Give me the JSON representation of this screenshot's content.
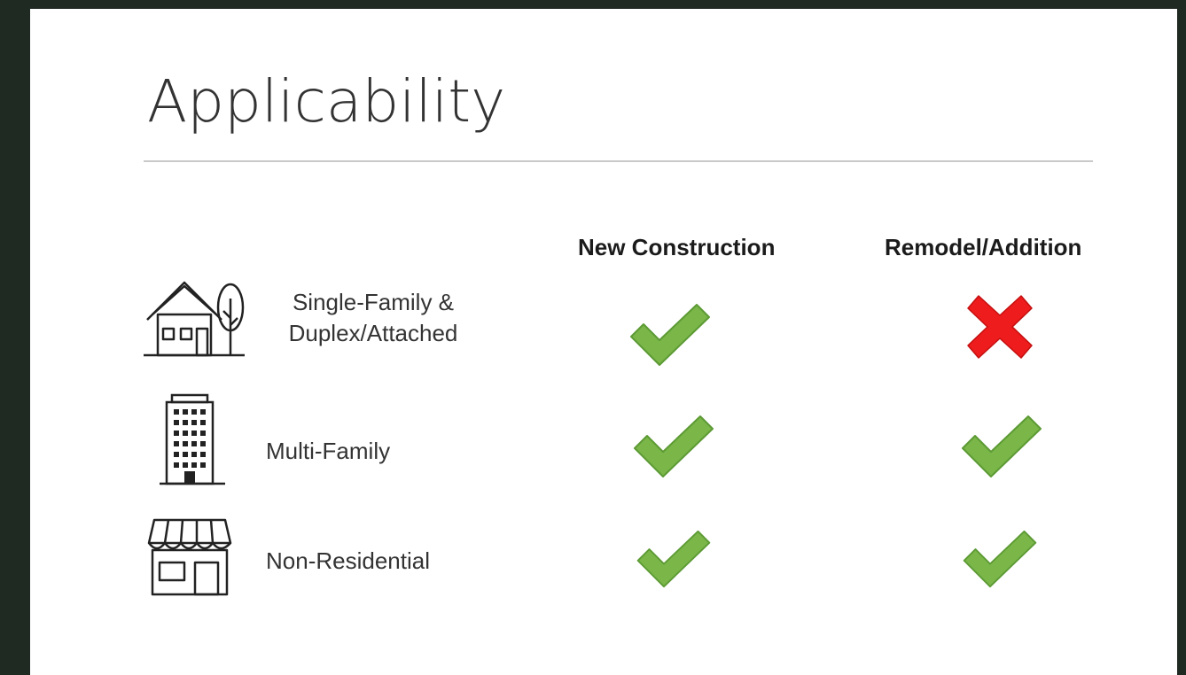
{
  "title": "Applicability",
  "columns": [
    "New Construction",
    "Remodel/Addition"
  ],
  "rows": [
    {
      "icon": "house-tree-icon",
      "label_line1": "Single-Family &",
      "label_line2": "Duplex/Attached",
      "new_construction": "check",
      "remodel_addition": "cross"
    },
    {
      "icon": "office-building-icon",
      "label": "Multi-Family",
      "new_construction": "check",
      "remodel_addition": "check"
    },
    {
      "icon": "storefront-icon",
      "label": "Non-Residential",
      "new_construction": "check",
      "remodel_addition": "check"
    }
  ],
  "colors": {
    "check": "#7ab648",
    "check_outline": "#5c9a34",
    "cross": "#ee1c1c",
    "background": "#1f2a22"
  }
}
